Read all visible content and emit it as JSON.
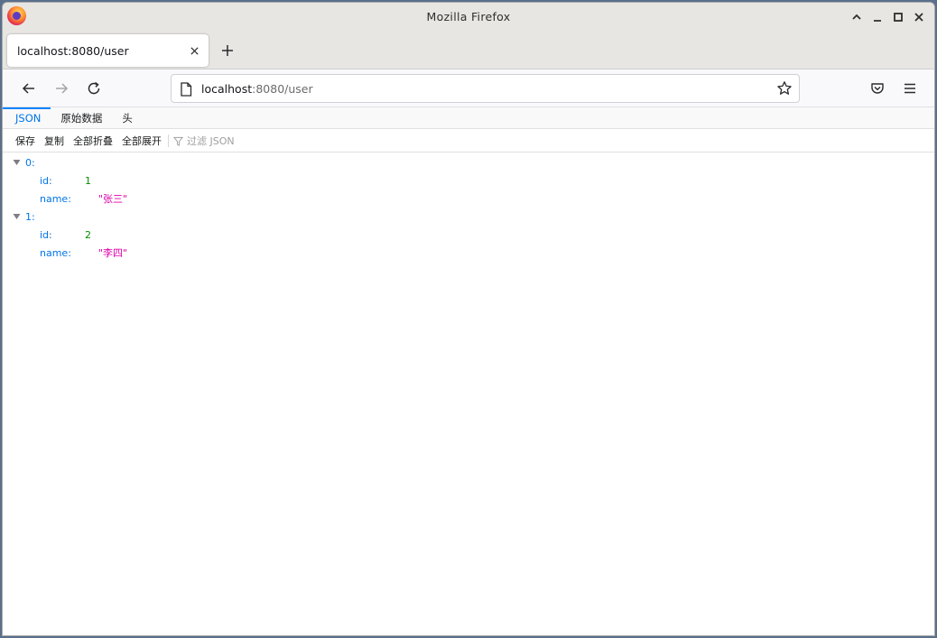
{
  "window": {
    "title": "Mozilla Firefox",
    "controls": [
      "chevron-up-icon",
      "minimize-icon",
      "maximize-icon",
      "close-icon"
    ]
  },
  "tabs": [
    {
      "label": "localhost:8080/user",
      "active": true
    }
  ],
  "navbar": {
    "url_host": "localhost",
    "url_rest": ":8080/user"
  },
  "viewer": {
    "tabs": [
      {
        "label": "JSON",
        "selected": true
      },
      {
        "label": "原始数据",
        "selected": false
      },
      {
        "label": "头",
        "selected": false
      }
    ],
    "toolbar": {
      "save": "保存",
      "copy": "复制",
      "collapse_all": "全部折叠",
      "expand_all": "全部展开",
      "filter_placeholder": "过滤 JSON"
    }
  },
  "json_tree": [
    {
      "key": "0:",
      "children": [
        {
          "key": "id:",
          "value": "1",
          "type": "number"
        },
        {
          "key": "name:",
          "value": "\"张三\"",
          "type": "string"
        }
      ]
    },
    {
      "key": "1:",
      "children": [
        {
          "key": "id:",
          "value": "2",
          "type": "number"
        },
        {
          "key": "name:",
          "value": "\"李四\"",
          "type": "string"
        }
      ]
    }
  ],
  "colors": {
    "accent": "#0a84ff",
    "json_key": "#0074e8",
    "json_number": "#058b00",
    "json_string": "#dd00a9"
  }
}
